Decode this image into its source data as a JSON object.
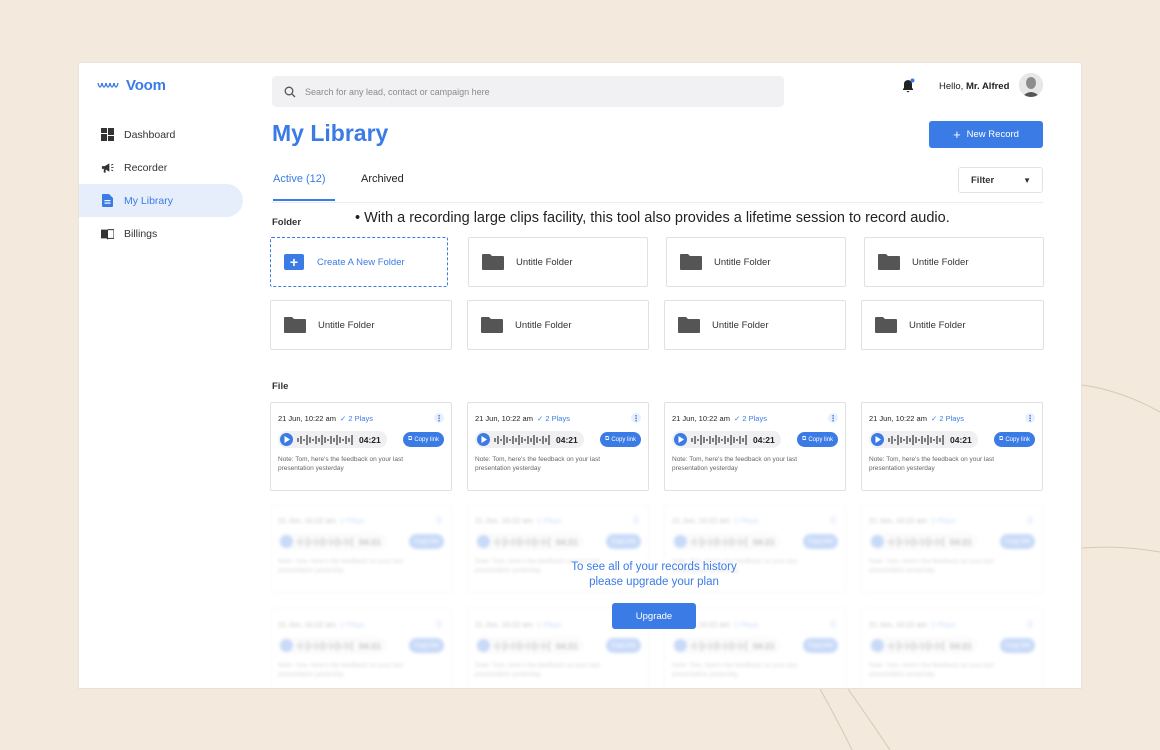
{
  "app": {
    "name": "Voom"
  },
  "sidebar": {
    "items": [
      {
        "label": "Dashboard",
        "icon": "dashboard-icon",
        "active": false
      },
      {
        "label": "Recorder",
        "icon": "megaphone-icon",
        "active": false
      },
      {
        "label": "My Library",
        "icon": "document-icon",
        "active": true
      },
      {
        "label": "Billings",
        "icon": "book-icon",
        "active": false
      }
    ]
  },
  "topbar": {
    "search_placeholder": "Search for any lead, contact or campaign here",
    "greeting": "Hello, ",
    "user_name": "Mr. Alfred"
  },
  "header": {
    "title": "My Library",
    "new_record_label": "New Record"
  },
  "tabs": {
    "active_label": "Active (12)",
    "archived_label": "Archived",
    "filter_label": "Filter"
  },
  "folder_section": {
    "label": "Folder",
    "note": "With a recording large clips facility, this tool also provides a lifetime session to record audio.",
    "create_label": "Create A New Folder",
    "folders": [
      "Untitle Folder",
      "Untitle Folder",
      "Untitle Folder",
      "Untitle Folder",
      "Untitle Folder",
      "Untitle Folder",
      "Untitle Folder"
    ]
  },
  "file_section": {
    "label": "File",
    "files": [
      {
        "date": "21 Jun, 10:22 am",
        "plays": "2 Plays",
        "duration": "04:21",
        "copy_label": "Copy link",
        "note": "Note: Tom, here's the feedback on your last presentation yesterday"
      },
      {
        "date": "21 Jun, 10:22 am",
        "plays": "2 Plays",
        "duration": "04:21",
        "copy_label": "Copy link",
        "note": "Note: Tom, here's the feedback on your last presentation yesterday"
      },
      {
        "date": "21 Jun, 10:22 am",
        "plays": "2 Plays",
        "duration": "04:21",
        "copy_label": "Copy link",
        "note": "Note: Tom, here's the feedback on your last presentation yesterday"
      },
      {
        "date": "21 Jun, 10:22 am",
        "plays": "2 Plays",
        "duration": "04:21",
        "copy_label": "Copy link",
        "note": "Note: Tom, here's the feedback on your last presentation yesterday"
      }
    ]
  },
  "upgrade": {
    "line1": "To see all of your records history",
    "line2": "please upgrade your plan",
    "button_label": "Upgrade"
  },
  "colors": {
    "accent": "#3b7be6",
    "background": "#f3e9dc"
  }
}
